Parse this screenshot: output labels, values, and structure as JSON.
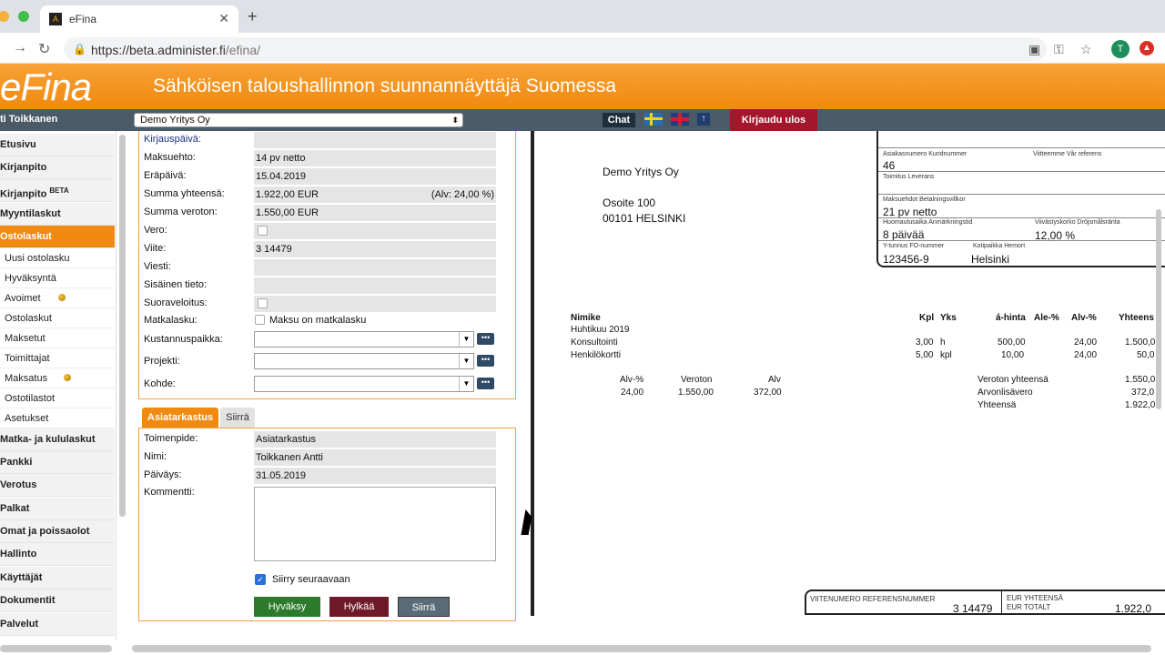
{
  "browser": {
    "tab_title": "eFina",
    "url_host": "https://beta.administer.fi",
    "url_path": "/efina/",
    "avatar_letter": "T"
  },
  "header": {
    "logo": "eFina",
    "tagline": "Sähköisen taloushallinnon suunnannäyttäjä Suomessa",
    "user": "ti Toikkanen",
    "company": "Demo Yritys Oy",
    "chat": "Chat",
    "logout": "Kirjaudu ulos",
    "accent": "#f08a10"
  },
  "sidebar": {
    "main": [
      "Etusivu",
      "Kirjanpito",
      "Kirjanpito",
      "Myyntilaskut",
      "Ostolaskut"
    ],
    "beta_badge": "BETA",
    "sub": [
      "Uusi ostolasku",
      "Hyväksyntä",
      "Avoimet",
      "Ostolaskut",
      "Maksetut",
      "Toimittajat",
      "Maksatus",
      "Ostotilastot",
      "Asetukset"
    ],
    "main2": [
      "Matka- ja kululaskut",
      "Pankki",
      "Verotus",
      "Palkat",
      "Omat ja poissaolot",
      "Hallinto",
      "Käyttäjät",
      "Dokumentit",
      "Palvelut"
    ]
  },
  "form": {
    "kirjauspaiva_label": "Kirjauspäivä:",
    "maksuehto_label": "Maksuehto:",
    "maksuehto": "14 pv netto",
    "erapaiva_label": "Eräpäivä:",
    "erapaiva": "15.04.2019",
    "summa_label": "Summa yhteensä:",
    "summa": "1.922,00 EUR",
    "alv": "(Alv: 24,00 %)",
    "veroton_label": "Summa veroton:",
    "veroton": "1.550,00 EUR",
    "vero_label": "Vero:",
    "viite_label": "Viite:",
    "viite": "3 14479",
    "viesti_label": "Viesti:",
    "sisainen_label": "Sisäinen tieto:",
    "suoraveloitus_label": "Suoraveloitus:",
    "matkalasku_label": "Matkalasku:",
    "matkalasku_check": "Maksu on matkalasku",
    "kustannus_label": "Kustannuspaikka:",
    "projekti_label": "Projekti:",
    "kohde_label": "Kohde:"
  },
  "approval": {
    "tab_active": "Asiatarkastus",
    "tab_other": "Siirrä",
    "toimenpide_label": "Toimenpide:",
    "toimenpide": "Asiatarkastus",
    "nimi_label": "Nimi:",
    "nimi": "Toikkanen Antti",
    "paivays_label": "Päiväys:",
    "paivays": "31.05.2019",
    "kommentti_label": "Kommentti:",
    "next_label": "Siirry seuraavaan",
    "approve": "Hyväksy",
    "reject": "Hylkää",
    "move": "Siirrä"
  },
  "invoice": {
    "recipient_name": "Demo Yritys Oy",
    "address1": "Osoite 100",
    "address2": "00101 HELSINKI",
    "asiakasnumero_label": "Asiakasnumero Kundnummer",
    "asiakasnumero": "46",
    "viitteemme_label": "Viitteemme Vår referens",
    "toimitus_label": "Toimitus Leverans",
    "maksuehdot_label": "Maksuehdot Betalningsvillkor",
    "maksuehdot": "21 pv netto",
    "huomautus_label": "Huomautusaika Anmärkningstid",
    "huomautus": "8 päivää",
    "viivastys_label": "Viivästyskorko Dröjsmålsränta",
    "viivastys": "12,00 %",
    "ytunnus_label": "Y-tunnus FO-nummer",
    "ytunnus": "123456-9",
    "kotipaikka_label": "Kotipaikka Hemort",
    "kotipaikka": "Helsinki",
    "table_headers": [
      "Nimike",
      "Kpl",
      "Yks",
      "á-hinta",
      "Ale-%",
      "Alv-%",
      "Yhteens"
    ],
    "period": "Huhtikuu 2019",
    "rows": [
      {
        "name": "Konsultointi",
        "qty": "3,00",
        "unit": "h",
        "price": "500,00",
        "vat": "24,00",
        "total": "1.500,0"
      },
      {
        "name": "Henkilökortti",
        "qty": "5,00",
        "unit": "kpl",
        "price": "10,00",
        "vat": "24,00",
        "total": "50,0"
      }
    ],
    "vat_headers": [
      "Alv-%",
      "Veroton",
      "Alv"
    ],
    "vat_row": [
      "24,00",
      "1.550,00",
      "372,00"
    ],
    "totals": [
      {
        "label": "Veroton yhteensä",
        "value": "1.550,0"
      },
      {
        "label": "Arvonlisävero",
        "value": "372,0"
      },
      {
        "label": "Yhteensä",
        "value": "1.922,0"
      }
    ],
    "ref_label": "VIITENUMERO  REFERENSNUMMER",
    "ref_value": "3 14479",
    "eur_label1": "EUR YHTEENSÄ",
    "eur_label2": "EUR TOTALT",
    "eur_value": "1.922,0"
  }
}
